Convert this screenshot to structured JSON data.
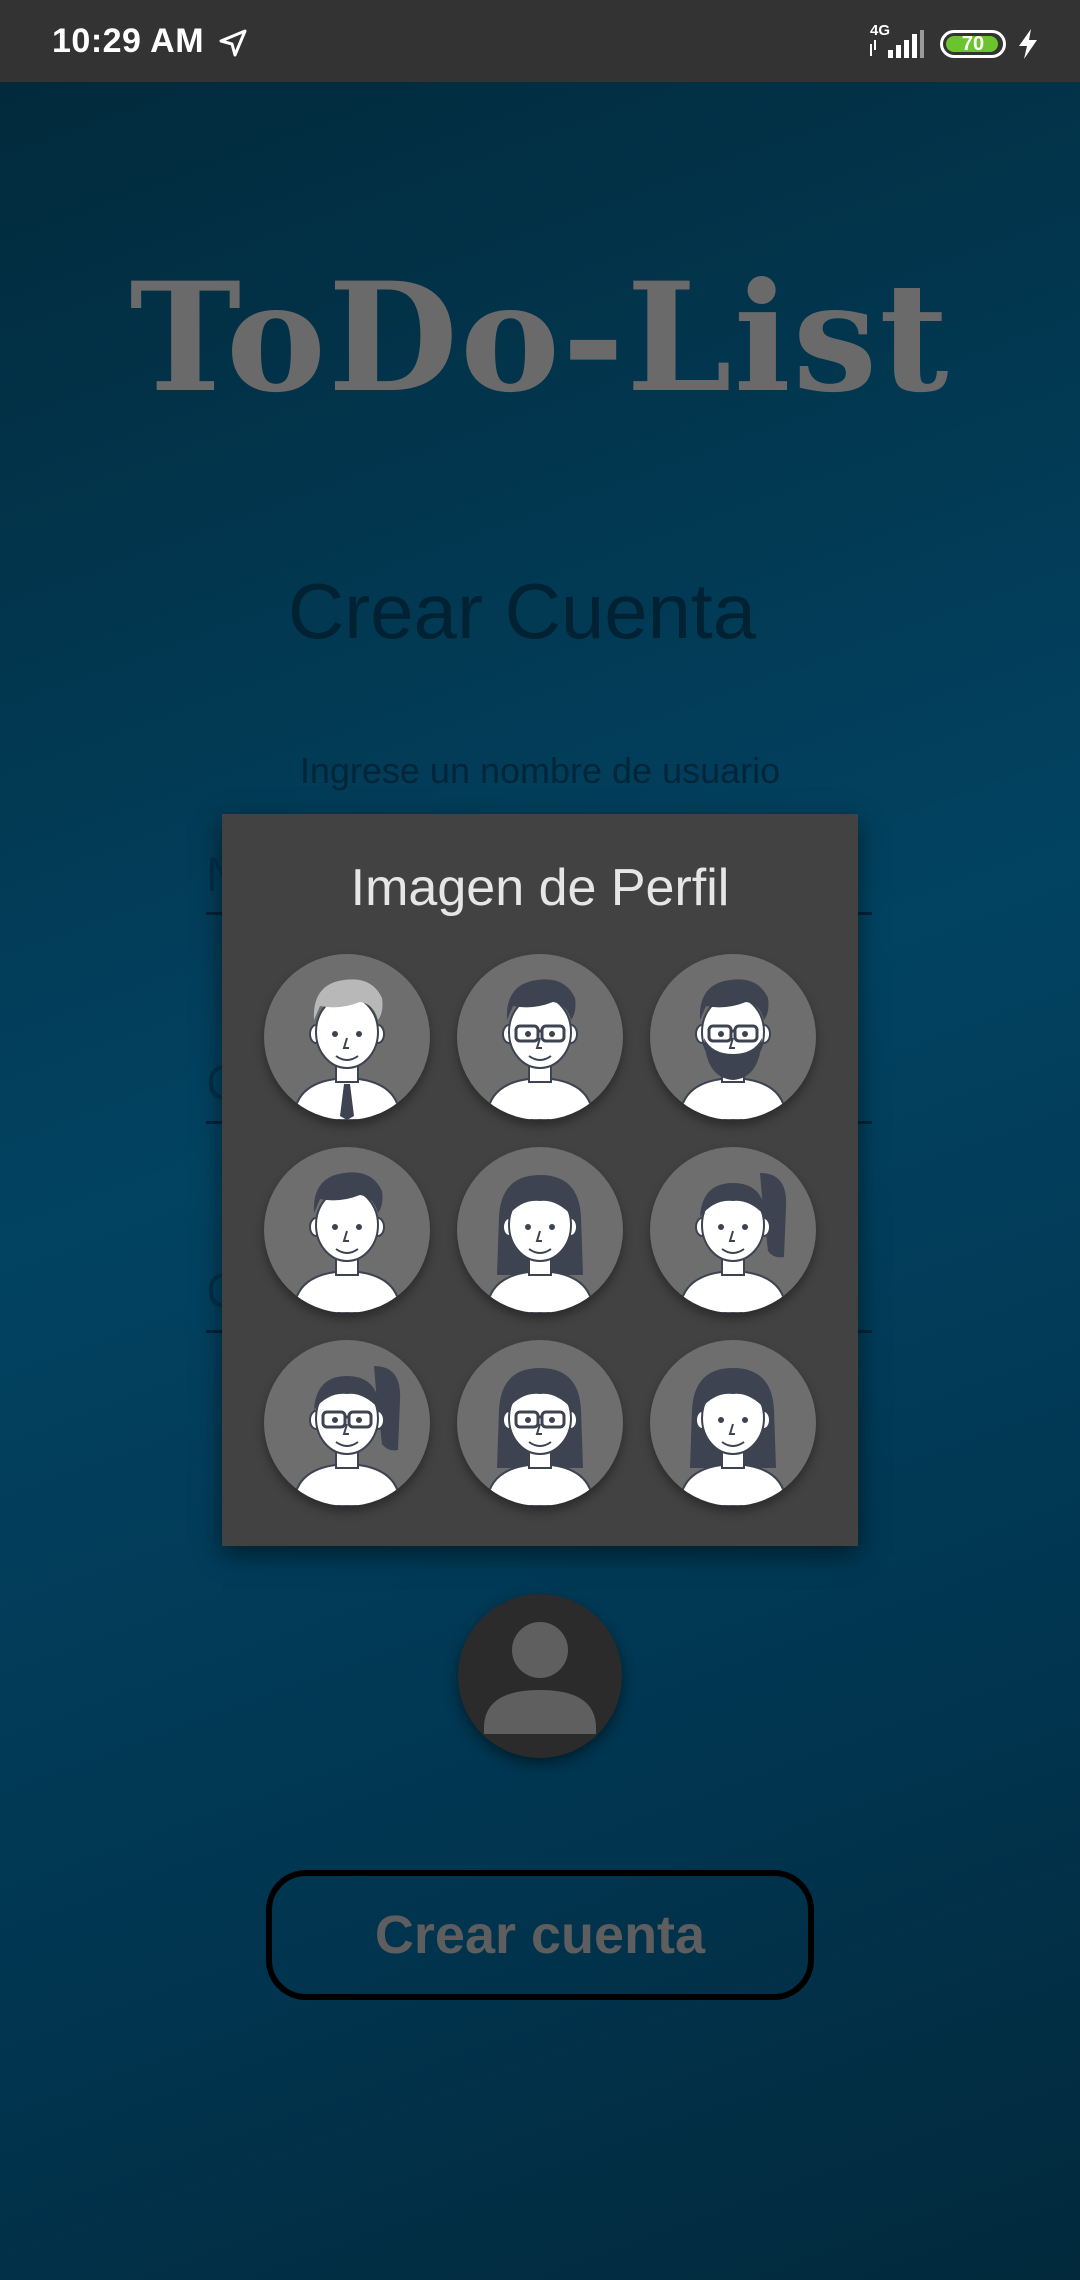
{
  "status_bar": {
    "time": "10:29 AM",
    "network": "4G",
    "battery": "70",
    "icons": [
      "location-arrow-icon",
      "signal-icon",
      "battery-icon",
      "charging-icon"
    ]
  },
  "app": {
    "title": "ToDo-List",
    "heading": "Crear Cuenta",
    "username_hint": "Ingrese un nombre de usuario",
    "fields": [
      {
        "visible_text": "N"
      },
      {
        "visible_text": "C"
      },
      {
        "visible_text": "C"
      }
    ],
    "create_button_label": "Crear cuenta"
  },
  "dialog": {
    "title": "Imagen de Perfil",
    "avatars": [
      {
        "name": "avatar-man-tie",
        "hair": "gray",
        "glasses": false,
        "beard": false,
        "long_hair": false,
        "ponytail": false
      },
      {
        "name": "avatar-man-glasses",
        "hair": "dark",
        "glasses": true,
        "beard": false,
        "long_hair": false,
        "ponytail": false
      },
      {
        "name": "avatar-man-beard-glasses",
        "hair": "dark",
        "glasses": true,
        "beard": true,
        "long_hair": false,
        "ponytail": false
      },
      {
        "name": "avatar-man-short-hair",
        "hair": "dark",
        "glasses": false,
        "beard": false,
        "long_hair": false,
        "ponytail": false
      },
      {
        "name": "avatar-woman-long-hair",
        "hair": "dark",
        "glasses": false,
        "beard": false,
        "long_hair": true,
        "ponytail": false
      },
      {
        "name": "avatar-woman-ponytail",
        "hair": "dark",
        "glasses": false,
        "beard": false,
        "long_hair": false,
        "ponytail": true
      },
      {
        "name": "avatar-woman-ponytail-glasses",
        "hair": "dark",
        "glasses": true,
        "beard": false,
        "long_hair": false,
        "ponytail": true
      },
      {
        "name": "avatar-woman-long-hair-glasses",
        "hair": "dark",
        "glasses": true,
        "beard": false,
        "long_hair": true,
        "ponytail": false
      },
      {
        "name": "avatar-woman-hoodie",
        "hair": "dark",
        "glasses": false,
        "beard": false,
        "long_hair": true,
        "ponytail": false
      }
    ]
  },
  "colors": {
    "background_start": "#022a3c",
    "background_mid": "#024362",
    "dialog": "#424242",
    "avatar_circle": "#6e6e6e",
    "hair_dark": "#3d4350",
    "hair_gray": "#b8b8b8",
    "battery_fill": "#6bc42d"
  }
}
